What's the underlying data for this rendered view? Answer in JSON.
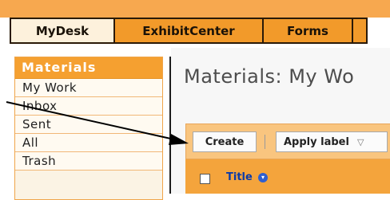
{
  "top_tabs": [
    "MyDesk",
    "ExhibitCenter",
    "Forms"
  ],
  "sidebar": {
    "header": "Materials",
    "items": [
      "My Work",
      "Inbox",
      "Sent",
      "All",
      "Trash"
    ]
  },
  "main": {
    "title": "Materials: My Wo",
    "toolbar": {
      "create_label": "Create",
      "apply_label": "Apply label",
      "apply_caret": "▽"
    },
    "table": {
      "title_column": "Title",
      "sort_icon": "▾"
    }
  }
}
